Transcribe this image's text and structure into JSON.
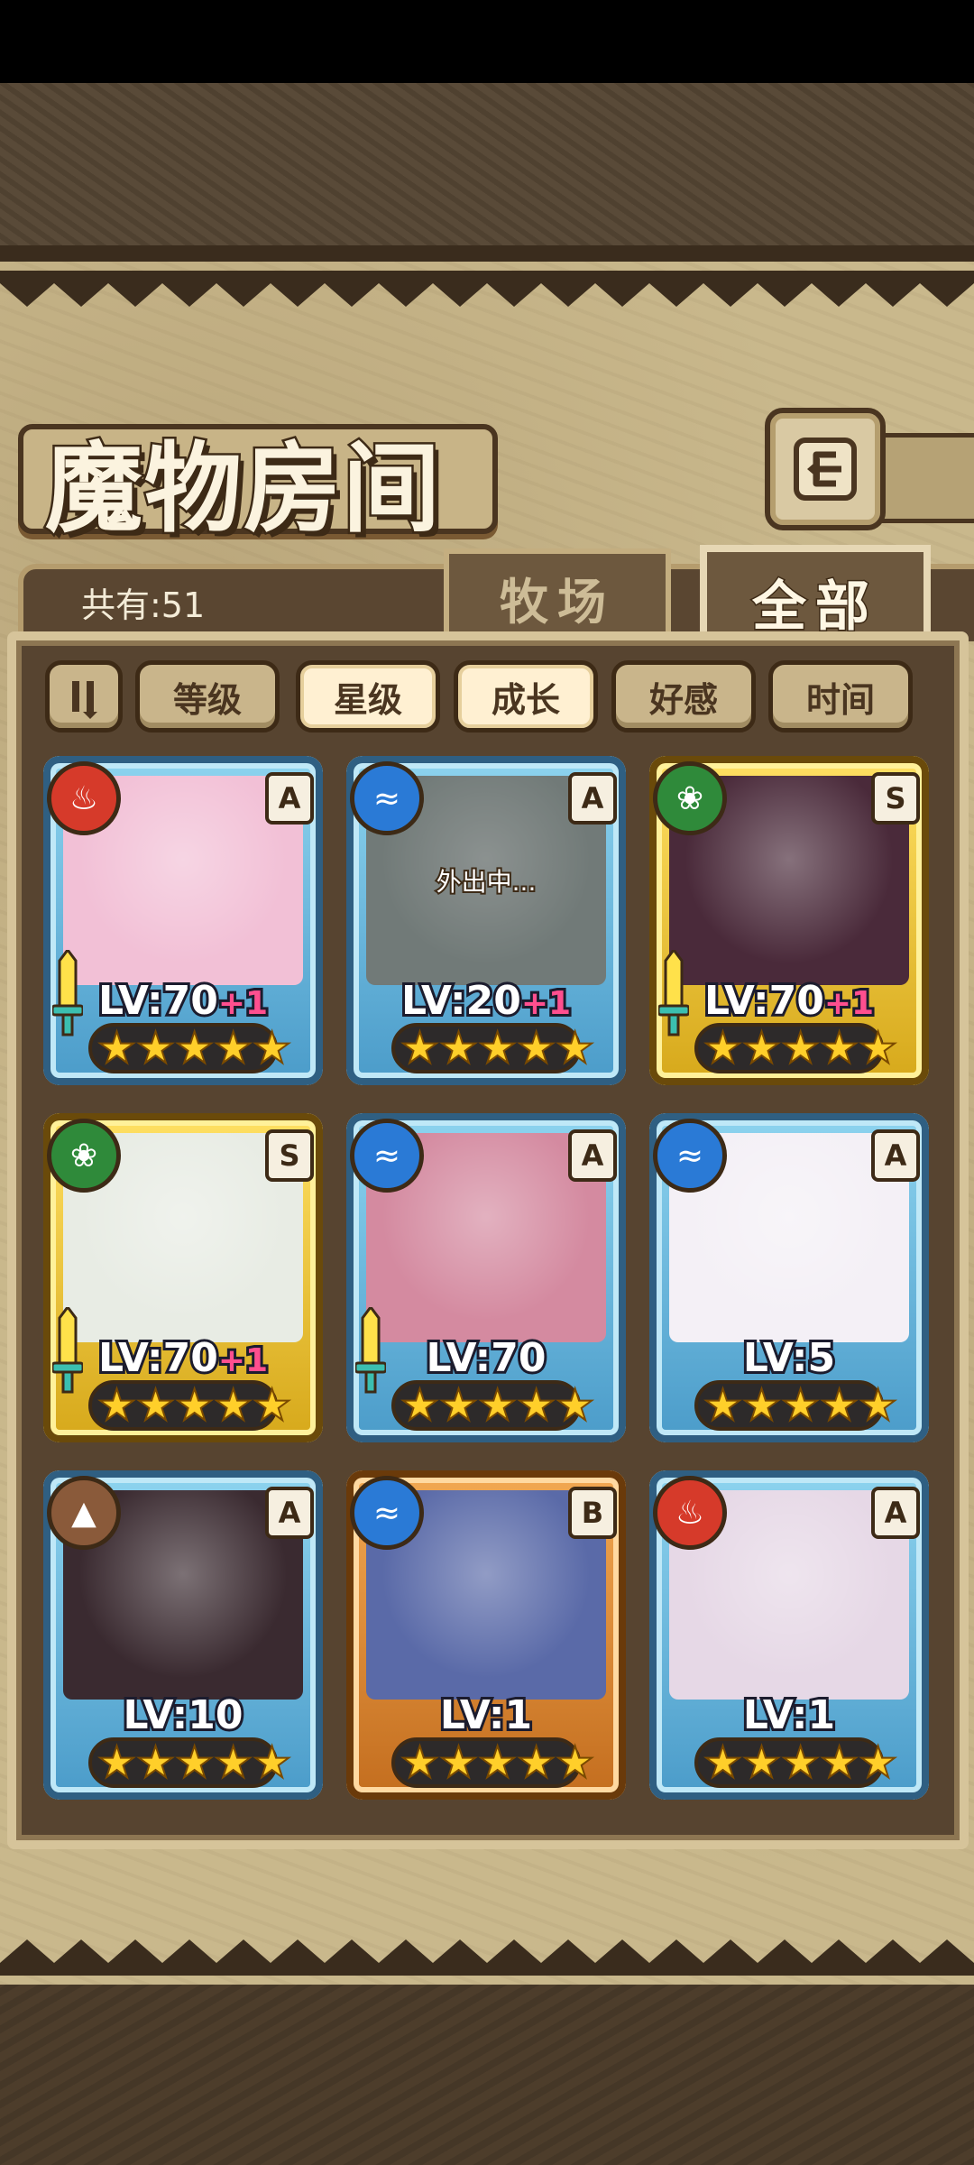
{
  "title": "魔物房间",
  "tabs": {
    "count_label": "共有:51",
    "ranch": "牧场",
    "all": "全部"
  },
  "sort_buttons": [
    "等级",
    "星级",
    "成长",
    "好感",
    "时间"
  ],
  "cards": [
    {
      "element": "fire",
      "rank": "A",
      "level": "LV:70",
      "bonus": "+1",
      "frame": "blue",
      "status": "",
      "weapon": true,
      "stars": 5,
      "portrait": "#f2c0d6"
    },
    {
      "element": "water",
      "rank": "A",
      "level": "LV:20",
      "bonus": "+1",
      "frame": "blue",
      "status": "外出中...",
      "weapon": false,
      "stars": 5,
      "portrait": "#8ea6a0"
    },
    {
      "element": "wood",
      "rank": "S",
      "level": "LV:70",
      "bonus": "+1",
      "frame": "gold",
      "status": "",
      "weapon": true,
      "stars": 5,
      "portrait": "#4a2a3a"
    },
    {
      "element": "wood",
      "rank": "S",
      "level": "LV:70",
      "bonus": "+1",
      "frame": "gold",
      "status": "",
      "weapon": true,
      "stars": 5,
      "portrait": "#e8ece4"
    },
    {
      "element": "water",
      "rank": "A",
      "level": "LV:70",
      "bonus": "",
      "frame": "blue",
      "status": "",
      "weapon": true,
      "stars": 5,
      "portrait": "#d48aa0"
    },
    {
      "element": "water",
      "rank": "A",
      "level": "LV:5",
      "bonus": "",
      "frame": "blue",
      "status": "",
      "weapon": false,
      "stars": 5,
      "portrait": "#f4f0f6"
    },
    {
      "element": "earth",
      "rank": "A",
      "level": "LV:10",
      "bonus": "",
      "frame": "blue",
      "status": "",
      "weapon": false,
      "stars": 5,
      "portrait": "#3a2a30"
    },
    {
      "element": "water",
      "rank": "B",
      "level": "LV:1",
      "bonus": "",
      "frame": "bronze",
      "status": "",
      "weapon": false,
      "stars": 5,
      "portrait": "#5a6aa8"
    },
    {
      "element": "fire",
      "rank": "A",
      "level": "LV:1",
      "bonus": "",
      "frame": "blue",
      "status": "",
      "weapon": false,
      "stars": 5,
      "portrait": "#e6d8e6"
    }
  ],
  "icons": {
    "back": "back-arrow-icon",
    "sort_toggle": "sort-toggle-icon",
    "fire": "fire-element-icon",
    "water": "water-element-icon",
    "wood": "leaf-element-icon",
    "earth": "mountain-element-icon",
    "star": "star-icon",
    "weapon": "sword-icon"
  },
  "colors": {
    "panel": "#574430",
    "accent_bonus": "#ff4f8f",
    "star": "#ffcf2a"
  }
}
